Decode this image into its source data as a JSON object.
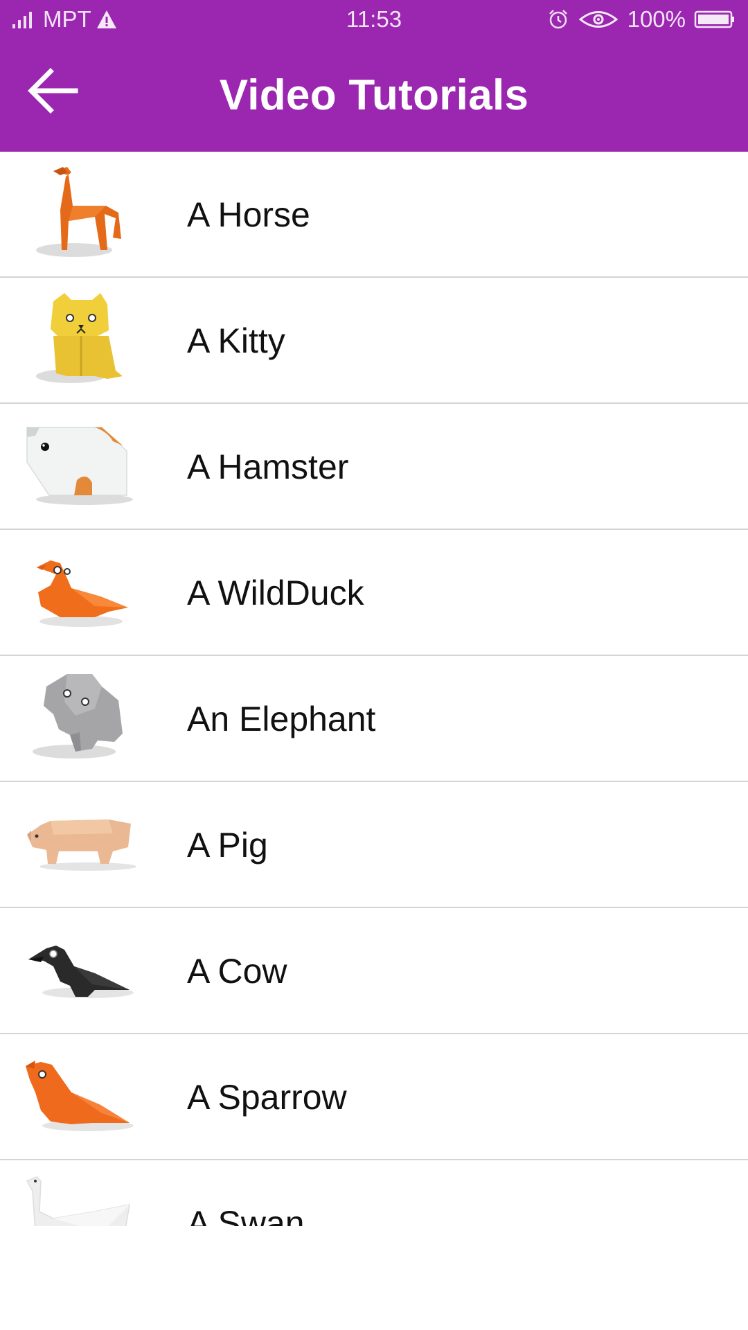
{
  "status_bar": {
    "carrier": "MPT",
    "time": "11:53",
    "battery": "100%",
    "icons": [
      "signal-icon",
      "warning-icon",
      "alarm-icon",
      "eye-icon",
      "battery-icon"
    ]
  },
  "app_bar": {
    "title": "Video Tutorials",
    "back_icon": "arrow-left-icon"
  },
  "colors": {
    "primary": "#9b27b1",
    "divider": "#d4d4d4",
    "text": "#111111"
  },
  "tutorials": [
    {
      "label": "A Horse",
      "icon": "origami-horse-icon"
    },
    {
      "label": "A Kitty",
      "icon": "origami-kitty-icon"
    },
    {
      "label": "A Hamster",
      "icon": "origami-hamster-icon"
    },
    {
      "label": "A WildDuck",
      "icon": "origami-wildduck-icon"
    },
    {
      "label": "An Elephant",
      "icon": "origami-elephant-icon"
    },
    {
      "label": "A Pig",
      "icon": "origami-pig-icon"
    },
    {
      "label": "A Cow",
      "icon": "origami-crow-icon"
    },
    {
      "label": "A Sparrow",
      "icon": "origami-sparrow-icon"
    },
    {
      "label": "A Swan",
      "icon": "origami-swan-icon"
    }
  ]
}
